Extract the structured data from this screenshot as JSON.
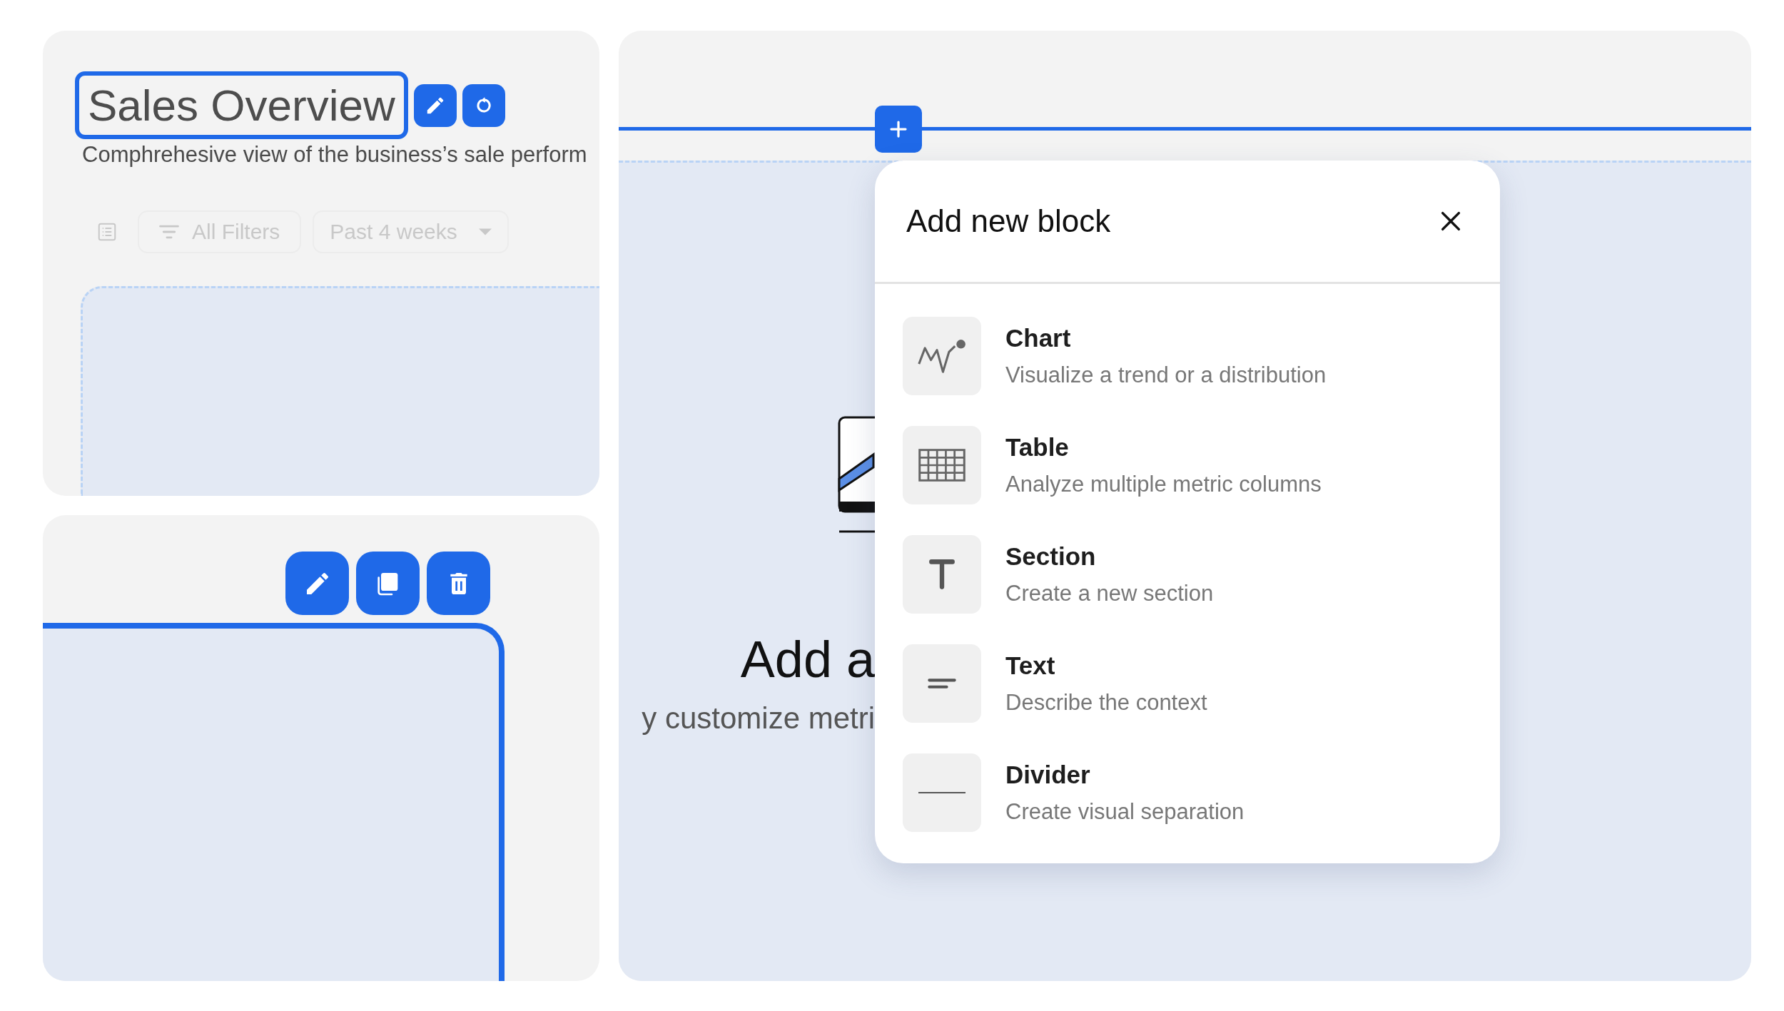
{
  "overview": {
    "title": "Sales Overview",
    "title_focused": true,
    "description": "Comphrehesive view of the business’s sale perform",
    "filters": [
      {
        "kind": "view-toggle",
        "disabled": true
      },
      {
        "kind": "filter",
        "label": "All Filters",
        "disabled": true
      },
      {
        "kind": "dropdown",
        "label": "Past 4 weeks",
        "disabled": true
      }
    ]
  },
  "block_editor": {
    "block_selected": true,
    "tools": [
      {
        "kind": "edit"
      },
      {
        "kind": "duplicate"
      },
      {
        "kind": "delete"
      }
    ]
  },
  "canvas": {
    "empty_state": {
      "heading": "Add a",
      "description": "y customize metri"
    },
    "add_block_menu": {
      "title": "Add new block",
      "options": [
        {
          "kind": "chart",
          "label": "Chart",
          "description": "Visualize a trend or a distribution"
        },
        {
          "kind": "table",
          "label": "Table",
          "description": "Analyze multiple metric columns"
        },
        {
          "kind": "section",
          "label": "Section",
          "description": "Create a new section"
        },
        {
          "kind": "text",
          "label": "Text",
          "description": "Describe the context"
        },
        {
          "kind": "divider",
          "label": "Divider",
          "description": "Create visual separation"
        }
      ]
    }
  }
}
